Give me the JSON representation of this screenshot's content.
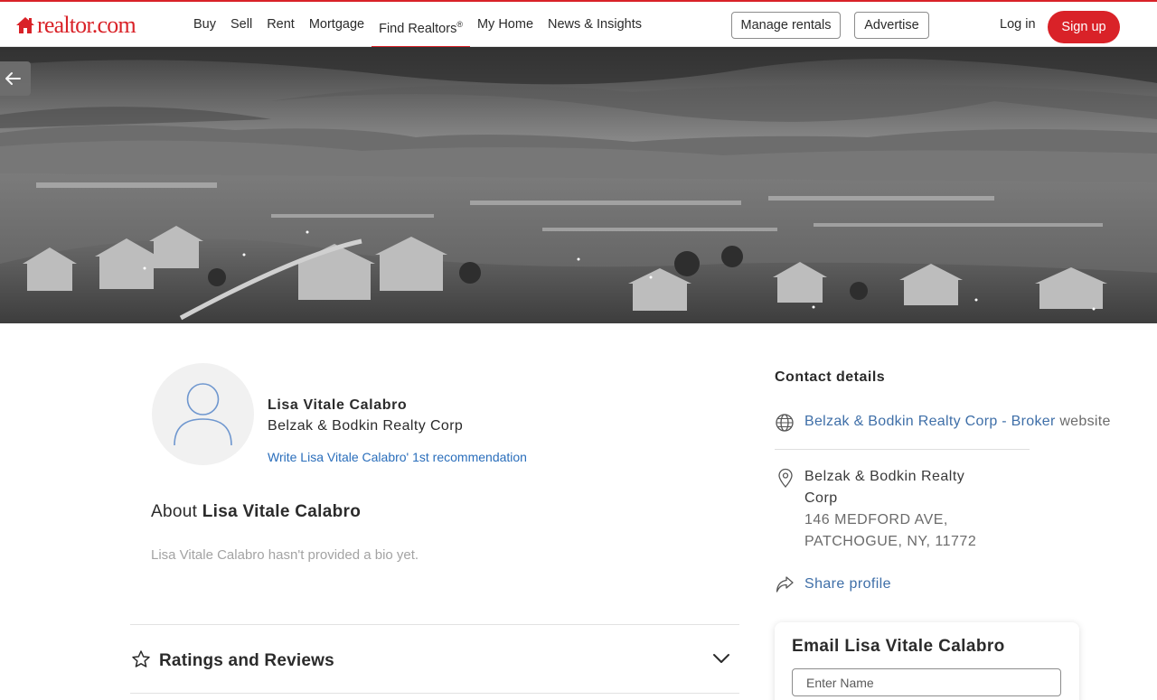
{
  "header": {
    "logo_text": "realtor.com",
    "nav": [
      {
        "label": "Buy"
      },
      {
        "label": "Sell"
      },
      {
        "label": "Rent"
      },
      {
        "label": "Mortgage"
      },
      {
        "label": "Find Realtors",
        "sup": "®"
      },
      {
        "label": "My Home"
      },
      {
        "label": "News & Insights"
      }
    ],
    "active_nav": "Find Realtors",
    "manage_rentals": "Manage rentals",
    "advertise": "Advertise",
    "login": "Log in",
    "signup": "Sign up"
  },
  "colors": {
    "brand_red": "#d92228",
    "link_blue": "#2a6ebb",
    "contact_link": "#3f6fa8"
  },
  "profile": {
    "name": "Lisa Vitale Calabro",
    "company": "Belzak & Bodkin Realty Corp",
    "write_recommendation": "Write Lisa Vitale Calabro' 1st recommendation",
    "about_prefix": "About",
    "bio": "Lisa Vitale Calabro hasn't provided a bio yet."
  },
  "reviews": {
    "title": "Ratings and Reviews"
  },
  "contact": {
    "title": "Contact details",
    "website_link": "Belzak & Bodkin Realty Corp - Broker",
    "website_suffix": "website",
    "address_line1": "Belzak & Bodkin Realty",
    "address_line2": "Corp",
    "address_line3": "146 MEDFORD AVE,",
    "address_line4": "PATCHOGUE, NY, 11772",
    "share": "Share profile"
  },
  "email_form": {
    "title": "Email Lisa Vitale Calabro",
    "name_placeholder": "Enter Name"
  },
  "icons": {
    "logo": "house-icon",
    "back": "arrow-left-icon",
    "avatar": "user-avatar-icon",
    "reviews": "star-icon",
    "expand": "chevron-down-icon",
    "website": "globe-icon",
    "address": "map-pin-icon",
    "share": "share-arrow-icon"
  }
}
